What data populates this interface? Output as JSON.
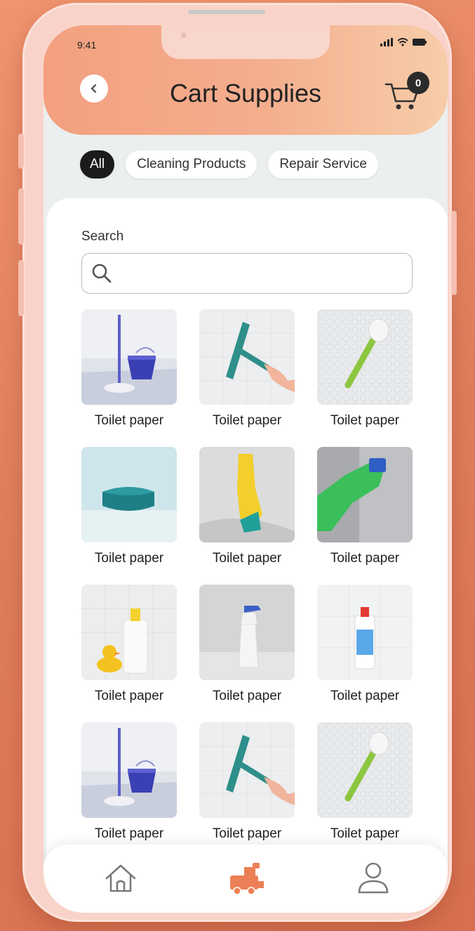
{
  "status_bar": {
    "time": "9:41"
  },
  "header": {
    "title": "Cart Supplies",
    "cart_count": "0"
  },
  "categories": [
    {
      "label": "All",
      "active": true
    },
    {
      "label": "Cleaning Products",
      "active": false
    },
    {
      "label": "Repair Service",
      "active": false
    }
  ],
  "search": {
    "label": "Search",
    "value": "",
    "placeholder": ""
  },
  "products": [
    {
      "label": "Toilet paper",
      "image": "mop-bucket"
    },
    {
      "label": "Toilet paper",
      "image": "squeegee"
    },
    {
      "label": "Toilet paper",
      "image": "scrub-brush"
    },
    {
      "label": "Toilet paper",
      "image": "sponge"
    },
    {
      "label": "Toilet paper",
      "image": "yellow-glove-wiping"
    },
    {
      "label": "Toilet paper",
      "image": "green-glove-cleaning"
    },
    {
      "label": "Toilet paper",
      "image": "rubber-duck-bottle"
    },
    {
      "label": "Toilet paper",
      "image": "spray-bottle"
    },
    {
      "label": "Toilet paper",
      "image": "detergent-bottle"
    },
    {
      "label": "Toilet paper",
      "image": "mop-bucket"
    },
    {
      "label": "Toilet paper",
      "image": "squeegee"
    },
    {
      "label": "Toilet paper",
      "image": "scrub-brush"
    }
  ],
  "bottom_nav": [
    {
      "icon": "home-icon",
      "active": false
    },
    {
      "icon": "train-toy-icon",
      "active": true
    },
    {
      "icon": "user-icon",
      "active": false
    }
  ],
  "colors": {
    "accent": "#f3a07f",
    "active_chip": "#1b1b1b",
    "nav_active": "#ec7f55"
  }
}
